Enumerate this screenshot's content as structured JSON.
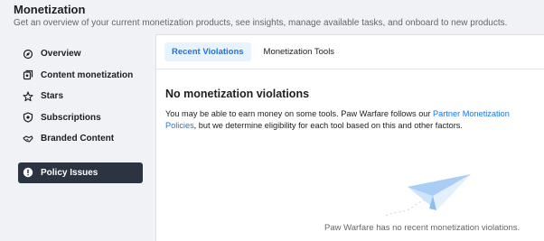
{
  "header": {
    "title": "Monetization",
    "subtitle": "Get an overview of your current monetization products, see insights, manage available tasks, and onboard to new products."
  },
  "sidebar": {
    "items": [
      {
        "label": "Overview",
        "icon": "overview-icon"
      },
      {
        "label": "Content monetization",
        "icon": "content-monetization-icon"
      },
      {
        "label": "Stars",
        "icon": "stars-icon"
      },
      {
        "label": "Subscriptions",
        "icon": "subscriptions-icon"
      },
      {
        "label": "Branded Content",
        "icon": "handshake-icon"
      },
      {
        "label": "Policy Issues",
        "icon": "alert-icon",
        "active": true
      }
    ]
  },
  "tabs": [
    {
      "label": "Recent Violations",
      "selected": true
    },
    {
      "label": "Monetization Tools",
      "selected": false
    }
  ],
  "main": {
    "heading": "No monetization violations",
    "text_before": "You may be able to earn money on some tools. Paw Warfare follows our ",
    "link": "Partner Monetization Policies",
    "text_after": ", but we determine eligibility for each tool based on this and other factors.",
    "empty_message": "Paw Warfare has no recent monetization violations."
  },
  "colors": {
    "accent": "#1b74e4",
    "active_bg": "#2b3440",
    "tab_selected_bg": "#e7f3ff"
  }
}
